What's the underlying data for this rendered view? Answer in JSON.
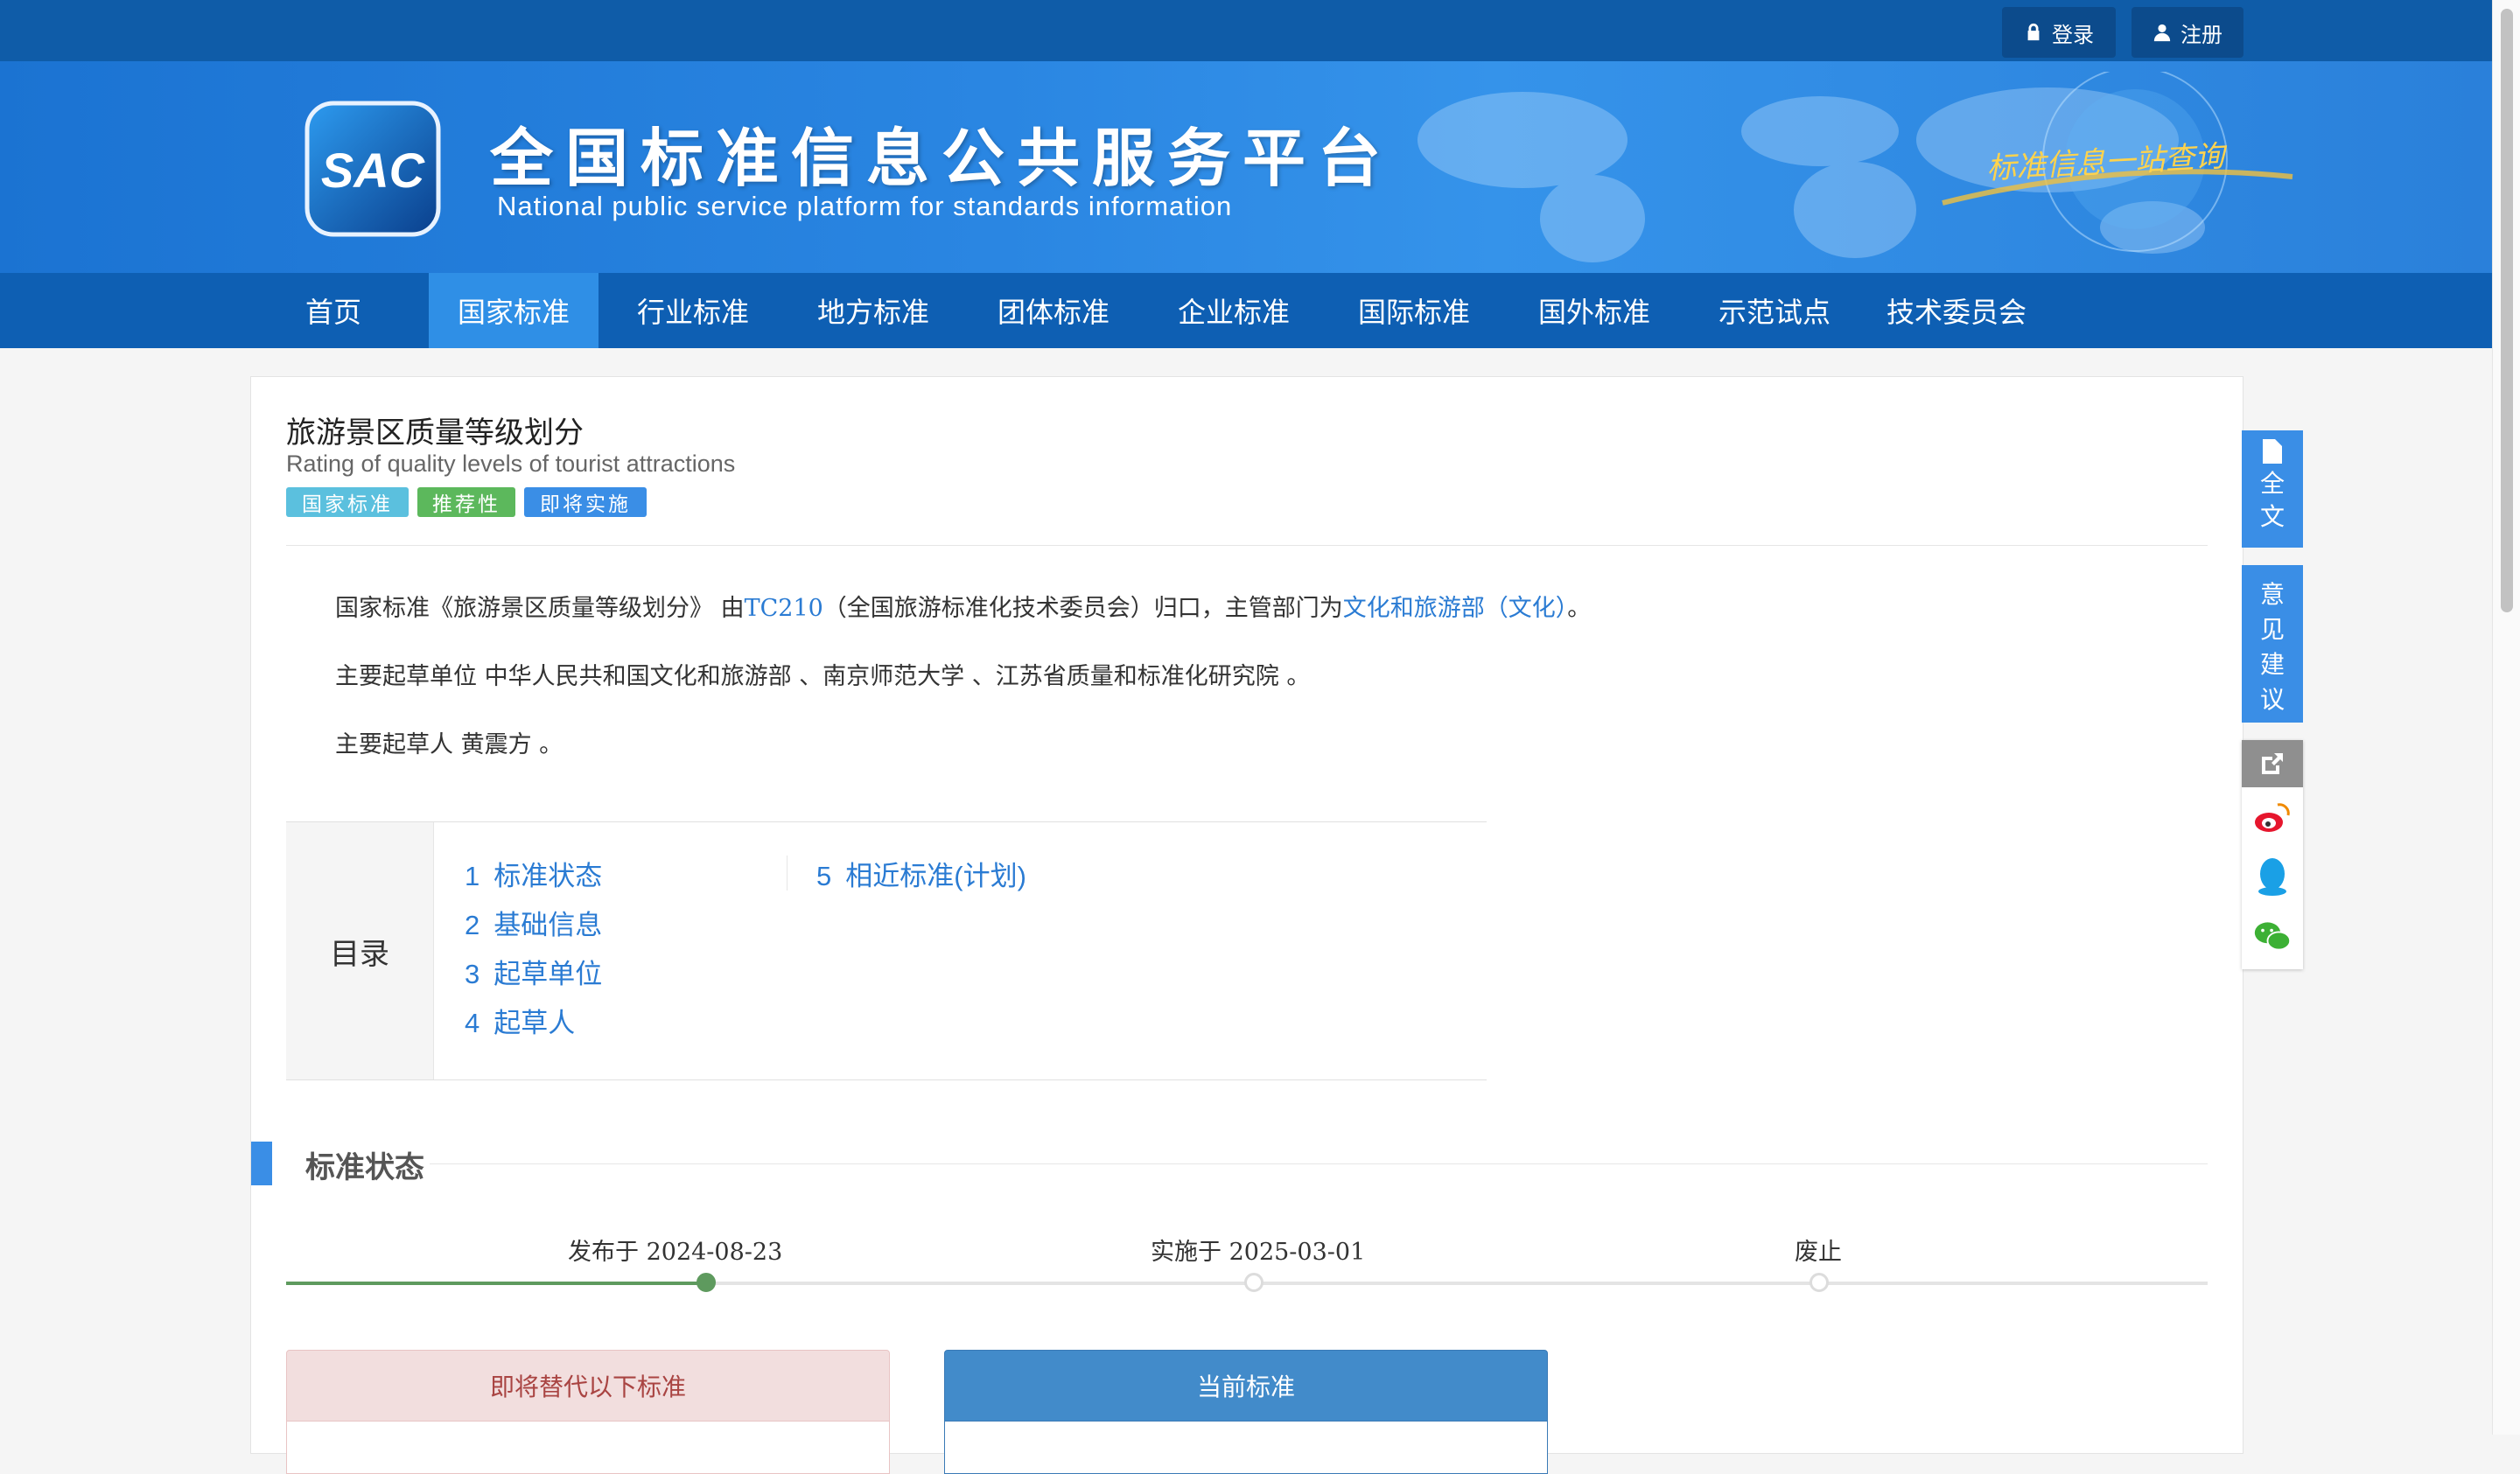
{
  "topbar": {
    "login_label": "登录",
    "register_label": "注册"
  },
  "banner": {
    "logo_text": "SAC",
    "title": "全国标准信息公共服务平台",
    "subtitle": "National public service platform  for standards information",
    "slogan": "标准信息一站查询"
  },
  "nav": {
    "items": [
      {
        "label": "首页"
      },
      {
        "label": "国家标准"
      },
      {
        "label": "行业标准"
      },
      {
        "label": "地方标准"
      },
      {
        "label": "团体标准"
      },
      {
        "label": "企业标准"
      },
      {
        "label": "国际标准"
      },
      {
        "label": "国外标准"
      },
      {
        "label": "示范试点"
      },
      {
        "label": "技术委员会"
      }
    ],
    "active_index": 1
  },
  "standard": {
    "title_cn": "旅游景区质量等级划分",
    "title_en": "Rating of quality levels of tourist attractions",
    "tags": [
      {
        "label": "国家标准",
        "color": "#5bc0de"
      },
      {
        "label": "推荐性",
        "color": "#5cb85c"
      },
      {
        "label": "即将实施",
        "color": "#3a8ee6"
      }
    ]
  },
  "intro": {
    "line1_prefix": "国家标准《旅游景区质量等级划分》 由",
    "committee_code": "TC210",
    "line1_middle": "（全国旅游标准化技术委员会）归口，主管部门为",
    "department": "文化和旅游部（文化）",
    "line1_suffix": "。",
    "line2": "主要起草单位 中华人民共和国文化和旅游部 、南京师范大学 、江苏省质量和标准化研究院 。",
    "line3": "主要起草人 黄震方 。"
  },
  "toc": {
    "label": "目录",
    "items": [
      {
        "num": "1",
        "label": "标准状态"
      },
      {
        "num": "2",
        "label": "基础信息"
      },
      {
        "num": "3",
        "label": "起草单位"
      },
      {
        "num": "4",
        "label": "起草人"
      },
      {
        "num": "5",
        "label": "相近标准(计划)"
      }
    ]
  },
  "status_section": {
    "title": "标准状态",
    "timeline": [
      {
        "label": "发布于 2024-08-23",
        "done": true
      },
      {
        "label": "实施于 2025-03-01",
        "done": false
      },
      {
        "label": "废止",
        "done": false
      }
    ],
    "replace_box_title": "即将替代以下标准",
    "current_box_title": "当前标准"
  },
  "sidebar_float": {
    "fulltext_label": "全文",
    "feedback_label": "意见建议"
  },
  "colors": {
    "nav_bg": "#0e5fb3",
    "nav_active": "#2f8fe6",
    "link": "#2a7bd3",
    "accent": "#3a8ee6",
    "timeline_done": "#5e9a5e"
  }
}
